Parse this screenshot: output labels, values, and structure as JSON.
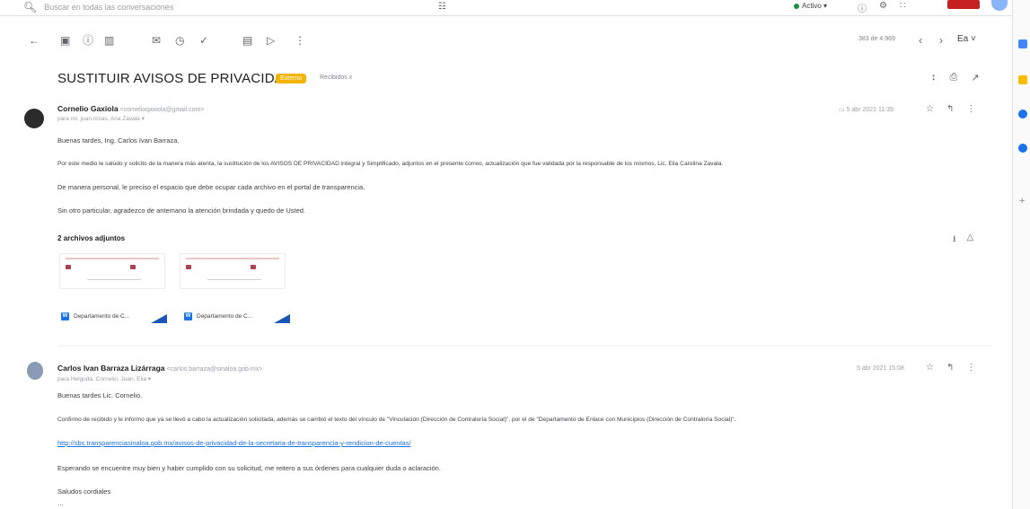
{
  "search": {
    "placeholder": "Buscar en todas las conversaciones"
  },
  "status": {
    "label": "Activo ▾"
  },
  "toolbar": {
    "counter": "383 de 4.969",
    "lang": "Ea ˅"
  },
  "email": {
    "subject": "SUSTITUIR AVISOS DE PRIVACIDAD",
    "badge": "Externo",
    "label": "Recibidos x"
  },
  "message1": {
    "sender": "Cornelio Gaxiola",
    "email": "<cornelioqaxiola@gmail.com>",
    "recipients": "para mí, juan.rosas, Ana Zavala ▾",
    "date": "5 abr 2021 11:39",
    "lines": [
      "Buenas tardes, Ing. Carlos Ivan Barraza.",
      "Por este medio le saludo y solicito de la manera más atenta, la sustitución de los AVISOS DE PRIVACIDAD integral y Simplificado, adjuntos en el presente correo, actualización que fue validada por la responsable de los mismos, Lic. Elia Carolina Zavala.",
      "De manera personal, le preciso el espacio que debe ocupar cada archivo en el portal de transparencia.",
      "Sin otro particular, agradezco de antemano la atención brindada y quedo de Usted."
    ],
    "attachments_title": "2 archivos adjuntos",
    "attachments": [
      "Departamento de C...",
      "Departamento de C..."
    ]
  },
  "message2": {
    "sender": "Carlos Ivan Barraza Lizárraga",
    "email": "<carlos.barraza@sinaloa.gob.mx>",
    "recipients": "para Helguda, Cornelio, Juan, Elia ▾",
    "date": "5 abr 2021 15:08",
    "lines": [
      "Buenas tardes Lic. Cornelio.",
      "Confirmo de recibido y le informo que ya se llevó a cabo la actualización solicitada, además se cambió el texto del vínculo de \"Vinculación (Dirección de Contraloría Social)\", por el de \"Departamento de Enlace con Municipios (Dirección de Contraloría Social)\".",
      "Esperando se encuentre muy bien y haber cumplido con su solicitud, me reitero a sus órdenes para cualquier duda o aclaración.",
      "Saludos cordiales"
    ],
    "link": "http://sbs.transparenciasinaloa.gob.mx/avisos-de-privacidad-de-la-secretaria-de-transparencia-y-rendicion-de-cuentas/",
    "ellipsis": "..."
  },
  "colors": {
    "badge": "#f4b400",
    "link": "#1a73e8",
    "status": "#1e8e3e"
  }
}
